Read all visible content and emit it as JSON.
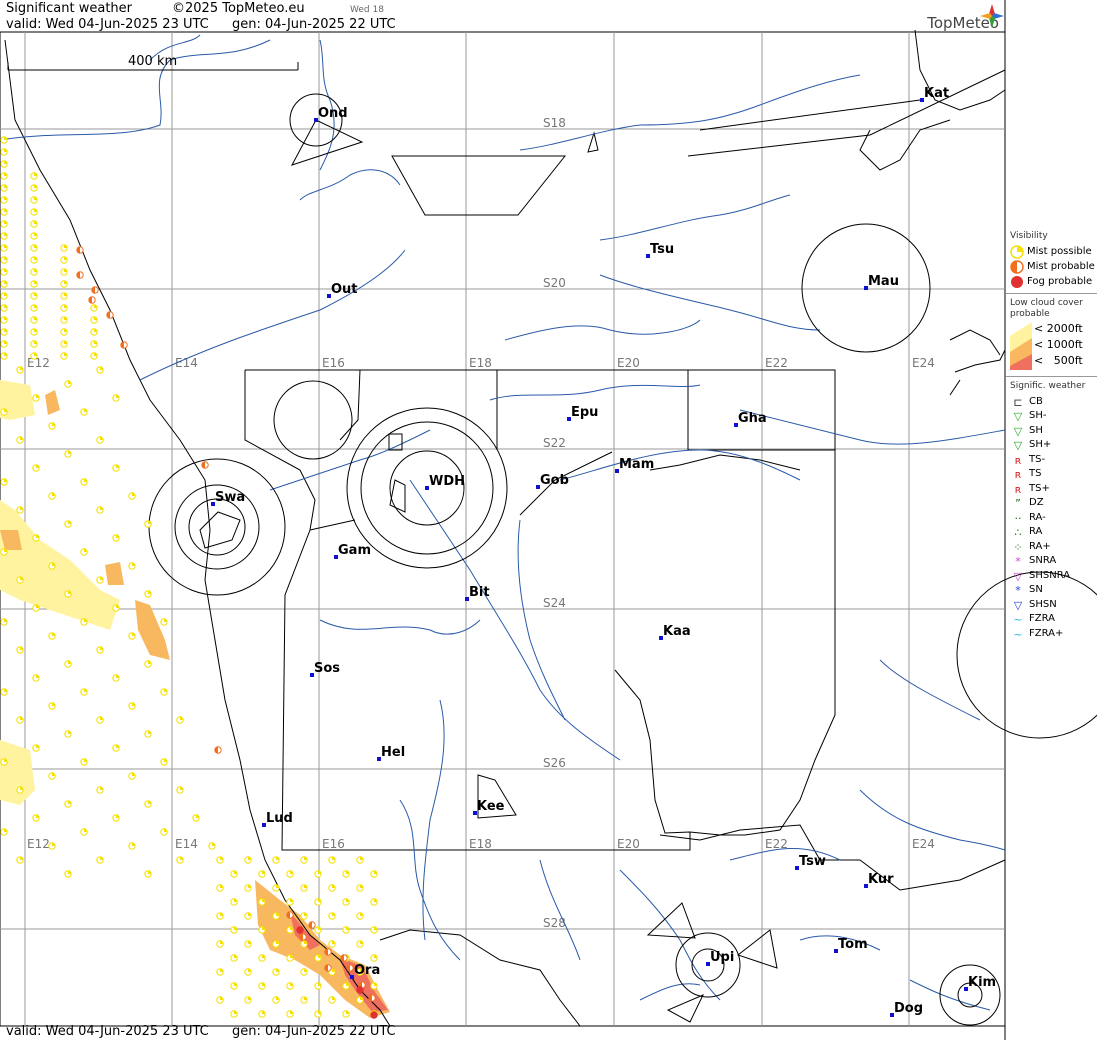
{
  "header": {
    "title": "Significant weather",
    "copyright": "©2025 TopMeteo.eu",
    "day_tag": "Wed 18",
    "valid": "valid:  Wed  04-Jun-2025  23 UTC",
    "generated": "gen: 04-Jun-2025 22 UTC",
    "brand": "TopMeteo"
  },
  "footer": {
    "valid": "valid:  Wed  04-Jun-2025  23 UTC",
    "generated": "gen: 04-Jun-2025 22 UTC"
  },
  "scale_bar": {
    "label": "400 km"
  },
  "longitude_labels": [
    "E12",
    "E14",
    "E16",
    "E18",
    "E20",
    "E22",
    "E24"
  ],
  "latitude_labels": [
    "S18",
    "S20",
    "S22",
    "S24",
    "S26",
    "S28"
  ],
  "cities": [
    {
      "name": "Ond"
    },
    {
      "name": "Kat"
    },
    {
      "name": "Tsu"
    },
    {
      "name": "Mau"
    },
    {
      "name": "Out"
    },
    {
      "name": "Epu"
    },
    {
      "name": "Gha"
    },
    {
      "name": "Mam"
    },
    {
      "name": "Swa"
    },
    {
      "name": "WDH"
    },
    {
      "name": "Gob"
    },
    {
      "name": "Gam"
    },
    {
      "name": "Bit"
    },
    {
      "name": "Kaa"
    },
    {
      "name": "Sos"
    },
    {
      "name": "Hel"
    },
    {
      "name": "Lud"
    },
    {
      "name": "Kee"
    },
    {
      "name": "Tsw"
    },
    {
      "name": "Kur"
    },
    {
      "name": "Tom"
    },
    {
      "name": "Upi"
    },
    {
      "name": "Ora"
    },
    {
      "name": "Kim"
    },
    {
      "name": "Dog"
    }
  ],
  "legend": {
    "visibility": {
      "title": "Visibility",
      "items": [
        {
          "label": "Mist possible",
          "color": "#f5e000"
        },
        {
          "label": "Mist probable",
          "color": "#f07020"
        },
        {
          "label": "Fog probable",
          "color": "#e03030"
        }
      ]
    },
    "low_cloud": {
      "title": "Low cloud cover probable",
      "items": [
        {
          "label": "< 2000ft",
          "color": "#fff3a0"
        },
        {
          "label": "< 1000ft",
          "color": "#f7b860"
        },
        {
          "label": "<   500ft",
          "color": "#f07060"
        }
      ]
    },
    "sigwx": {
      "title": "Signific. weather",
      "items": [
        {
          "symbol": "cb-icon",
          "label": "CB",
          "color": "#333333"
        },
        {
          "symbol": "sh-minus-icon",
          "label": "SH-",
          "color": "#22aa22"
        },
        {
          "symbol": "sh-icon",
          "label": "SH",
          "color": "#22aa22"
        },
        {
          "symbol": "sh-plus-icon",
          "label": "SH+",
          "color": "#22aa22"
        },
        {
          "symbol": "ts-minus-icon",
          "label": "TS-",
          "color": "#dd2222"
        },
        {
          "symbol": "ts-icon",
          "label": "TS",
          "color": "#dd2222"
        },
        {
          "symbol": "ts-plus-icon",
          "label": "TS+",
          "color": "#dd2222"
        },
        {
          "symbol": "dz-icon",
          "label": "DZ",
          "color": "#116611"
        },
        {
          "symbol": "ra-minus-icon",
          "label": "RA-",
          "color": "#116611"
        },
        {
          "symbol": "ra-icon",
          "label": "RA",
          "color": "#116611"
        },
        {
          "symbol": "ra-plus-icon",
          "label": "RA+",
          "color": "#116611"
        },
        {
          "symbol": "snra-icon",
          "label": "SNRA",
          "color": "#cc44cc"
        },
        {
          "symbol": "shsnra-icon",
          "label": "SHSNRA",
          "color": "#cc44cc"
        },
        {
          "symbol": "sn-icon",
          "label": "SN",
          "color": "#2244dd"
        },
        {
          "symbol": "shsn-icon",
          "label": "SHSN",
          "color": "#2244dd"
        },
        {
          "symbol": "fzra-icon",
          "label": "FZRA",
          "color": "#22bbdd"
        },
        {
          "symbol": "fzra-plus-icon",
          "label": "FZRA+",
          "color": "#22bbdd"
        }
      ]
    }
  },
  "colors": {
    "river": "#2a5aa8",
    "grid": "#9a9a9a",
    "border": "#000000",
    "mist_possible": "#f5e000",
    "mist_probable": "#f07020",
    "fog": "#e03030",
    "city_marker": "#1010d0"
  }
}
